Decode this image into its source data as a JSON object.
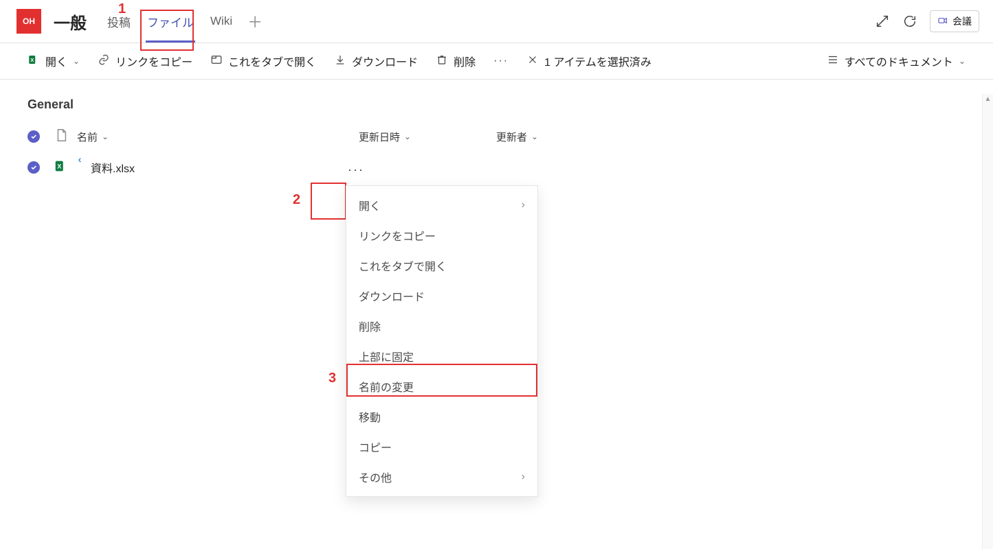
{
  "header": {
    "avatar_initials": "OH",
    "channel_title": "一般",
    "tabs": [
      {
        "label": "投稿",
        "active": false
      },
      {
        "label": "ファイル",
        "active": true
      },
      {
        "label": "Wiki",
        "active": false
      }
    ],
    "meet_label": "会議"
  },
  "toolbar": {
    "open_label": "開く",
    "copylink_label": "リンクをコピー",
    "opentab_label": "これをタブで開く",
    "download_label": "ダウンロード",
    "delete_label": "削除",
    "selection_label": "1 アイテムを選択済み",
    "viewswitch_label": "すべてのドキュメント"
  },
  "content": {
    "group_header": "General",
    "columns": {
      "name": "名前",
      "modified": "更新日時",
      "modified_by": "更新者"
    },
    "file": {
      "name": "資料.xlsx"
    }
  },
  "context_menu": {
    "items": [
      {
        "label": "開く",
        "has_submenu": true
      },
      {
        "label": "リンクをコピー"
      },
      {
        "label": "これをタブで開く"
      },
      {
        "label": "ダウンロード"
      },
      {
        "label": "削除"
      },
      {
        "label": "上部に固定"
      },
      {
        "label": "名前の変更",
        "highlight": true
      },
      {
        "label": "移動"
      },
      {
        "label": "コピー"
      },
      {
        "label": "その他",
        "has_submenu": true
      }
    ]
  },
  "annotations": {
    "a1": "1",
    "a2": "2",
    "a3": "3"
  }
}
